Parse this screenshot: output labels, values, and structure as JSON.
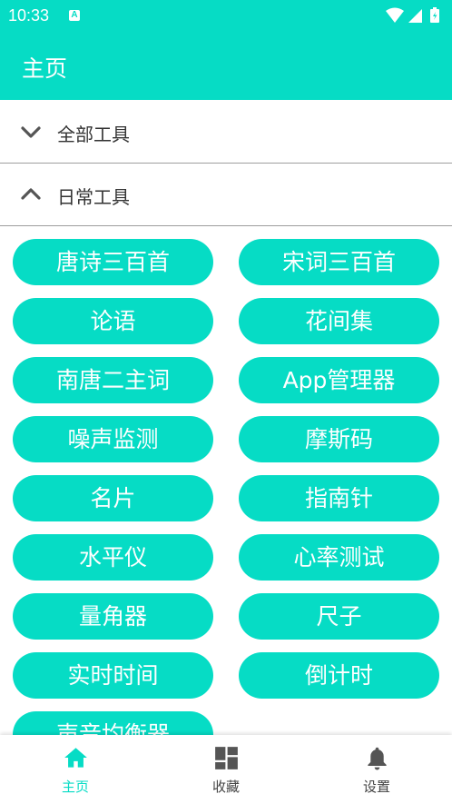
{
  "status_bar": {
    "time": "10:33",
    "notification_icon": "A",
    "icons": [
      "wifi-icon",
      "signal-icon",
      "battery-icon"
    ]
  },
  "app_bar": {
    "title": "主页"
  },
  "sections": [
    {
      "label": "全部工具",
      "expanded": false,
      "icon": "chevron-down-icon"
    },
    {
      "label": "日常工具",
      "expanded": true,
      "icon": "chevron-up-icon"
    }
  ],
  "tools": [
    "唐诗三百首",
    "宋词三百首",
    "论语",
    "花间集",
    "南唐二主词",
    "App管理器",
    "噪声监测",
    "摩斯码",
    "名片",
    "指南针",
    "水平仪",
    "心率测试",
    "量角器",
    "尺子",
    "实时时间",
    "倒计时",
    "声音均衡器"
  ],
  "bottom_nav": [
    {
      "label": "主页",
      "icon": "home-icon",
      "active": true
    },
    {
      "label": "收藏",
      "icon": "dashboard-icon",
      "active": false
    },
    {
      "label": "设置",
      "icon": "bell-icon",
      "active": false
    }
  ],
  "colors": {
    "accent": "#06dcc5",
    "text": "#333333",
    "divider": "#9e9e9e"
  }
}
